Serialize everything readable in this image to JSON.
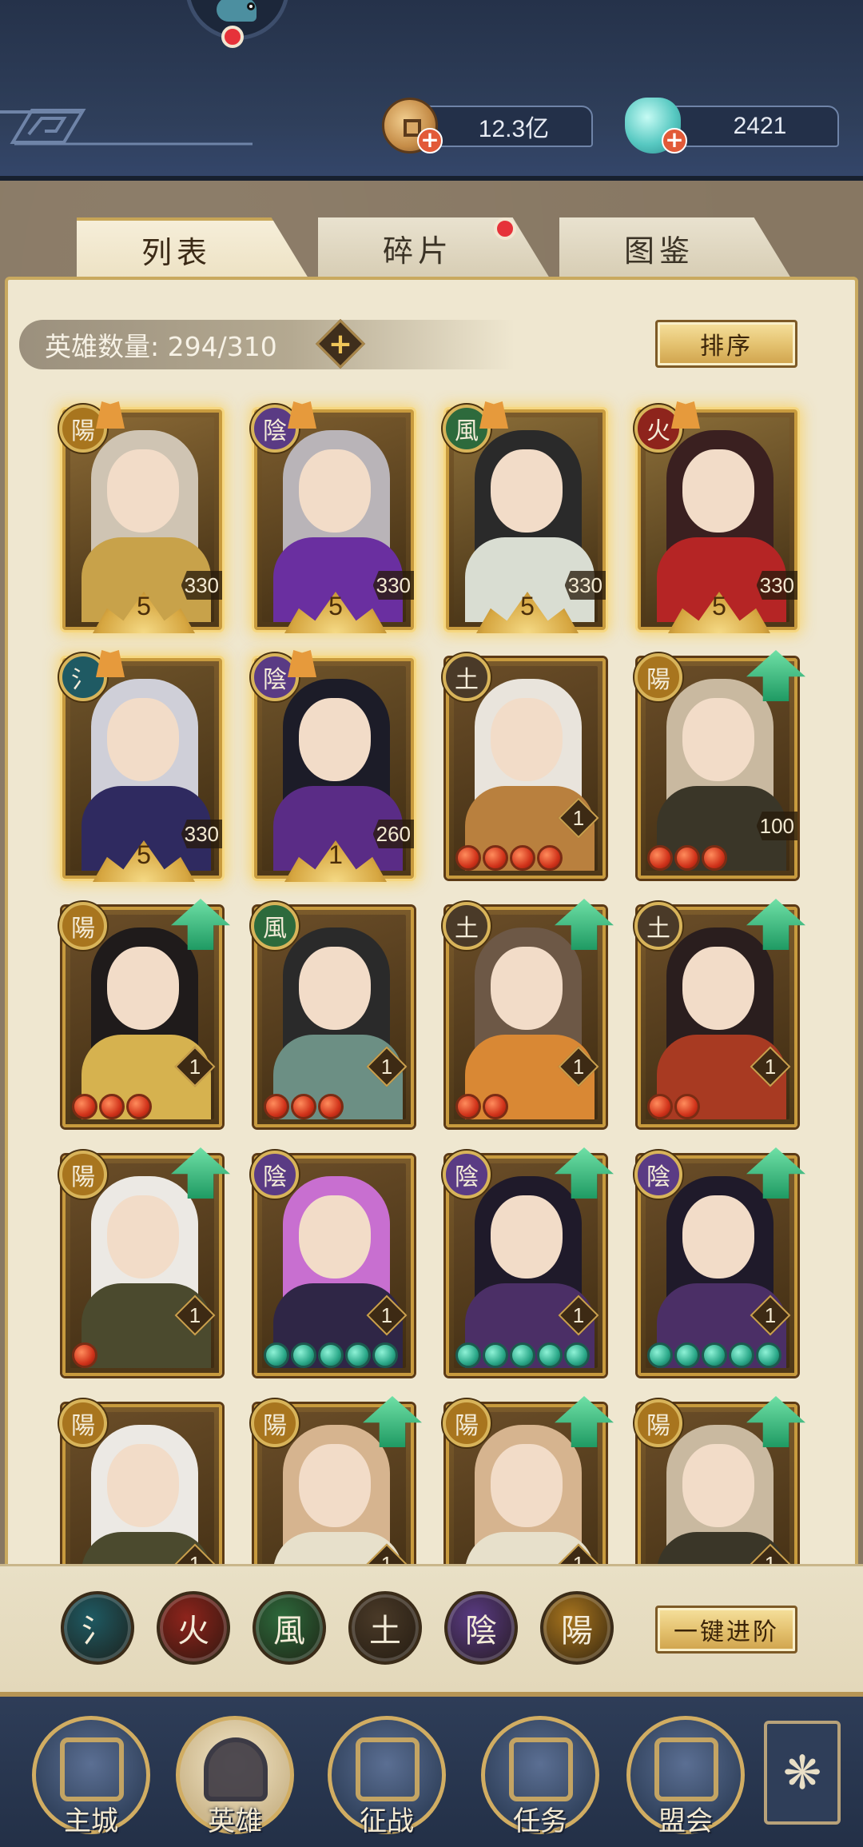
{
  "header": {
    "coins": "12.3亿",
    "gems": "2421"
  },
  "tabs": [
    {
      "label": "列表",
      "active": true
    },
    {
      "label": "碎片",
      "active": false,
      "has_dot": true
    },
    {
      "label": "图鉴",
      "active": false
    }
  ],
  "roster": {
    "count_label": "英雄数量: 294/310",
    "sort_label": "排序"
  },
  "elements": {
    "water": {
      "glyph": "氵",
      "color": "#1f5a63"
    },
    "fire": {
      "glyph": "火",
      "color": "#8e241c"
    },
    "wind": {
      "glyph": "風",
      "color": "#2d6a3c"
    },
    "earth": {
      "glyph": "土",
      "color": "#4a3a28"
    },
    "yin": {
      "glyph": "陰",
      "color": "#5a3b84"
    },
    "yang": {
      "glyph": "陽",
      "color": "#a8751e"
    }
  },
  "heroes": [
    {
      "element": "yang",
      "stars": "5",
      "level": "330",
      "hair": "#cfc4b3",
      "robe": "#c8a24a",
      "bg": "#8b6a36",
      "glow": true
    },
    {
      "element": "yin",
      "stars": "5",
      "level": "330",
      "hair": "#b9b4b8",
      "robe": "#6a2fa0",
      "bg": "#7b5c2e",
      "glow": true
    },
    {
      "element": "wind",
      "stars": "5",
      "level": "330",
      "hair": "#2a2a2a",
      "robe": "#d9ddd2",
      "bg": "#8a6d38",
      "glow": true
    },
    {
      "element": "fire",
      "stars": "5",
      "level": "330",
      "hair": "#3a2020",
      "robe": "#b52525",
      "bg": "#8a6d38",
      "glow": true
    },
    {
      "element": "water",
      "stars": "5",
      "level": "330",
      "hair": "#cfcfd8",
      "robe": "#2f2a60",
      "bg": "#6e532a",
      "glow": true
    },
    {
      "element": "yin",
      "stars": "1",
      "level": "260",
      "hair": "#1c1c28",
      "robe": "#5a2c86",
      "bg": "#6e532a",
      "glow": true
    },
    {
      "element": "earth",
      "level": "1",
      "hair": "#e9e4dc",
      "robe": "#b9803e",
      "bg": "#6a4d28",
      "beads": 4,
      "bead_type": "red"
    },
    {
      "element": "yang",
      "level": "100",
      "hair": "#c9b9a0",
      "robe": "#3a3628",
      "bg": "#6a4d28",
      "beads": 3,
      "bead_type": "red",
      "upgrade": true
    },
    {
      "element": "yang",
      "level": "1",
      "hair": "#1f1b1b",
      "robe": "#d6b24f",
      "bg": "#6a4d28",
      "beads": 3,
      "bead_type": "red",
      "upgrade": true
    },
    {
      "element": "wind",
      "level": "1",
      "hair": "#2a2a2a",
      "robe": "#6c8f84",
      "bg": "#6a4d28",
      "beads": 3,
      "bead_type": "red"
    },
    {
      "element": "earth",
      "level": "1",
      "hair": "#6d5846",
      "robe": "#d98834",
      "bg": "#6a4d28",
      "beads": 2,
      "bead_type": "red",
      "upgrade": true
    },
    {
      "element": "earth",
      "level": "1",
      "hair": "#2a1e1e",
      "robe": "#a83a22",
      "bg": "#6a4d28",
      "beads": 2,
      "bead_type": "red",
      "upgrade": true
    },
    {
      "element": "yang",
      "level": "1",
      "hair": "#ece9e4",
      "robe": "#4b4a2e",
      "bg": "#6a4d28",
      "beads": 1,
      "bead_type": "red",
      "upgrade": true
    },
    {
      "element": "yin",
      "level": "1",
      "hair": "#c86fd0",
      "robe": "#2f2646",
      "bg": "#6a4d28",
      "beads": 5,
      "bead_type": "jade"
    },
    {
      "element": "yin",
      "level": "1",
      "hair": "#1f1a2a",
      "robe": "#4b2f66",
      "bg": "#6a4d28",
      "beads": 5,
      "bead_type": "jade",
      "upgrade": true
    },
    {
      "element": "yin",
      "level": "1",
      "hair": "#1f1a2a",
      "robe": "#4b2f66",
      "bg": "#6a4d28",
      "beads": 5,
      "bead_type": "jade",
      "upgrade": true
    },
    {
      "element": "yang",
      "level": "1",
      "hair": "#ece9e4",
      "robe": "#4b4a2e",
      "bg": "#6a4d28"
    },
    {
      "element": "yang",
      "level": "1",
      "hair": "#d6b48f",
      "robe": "#e7e0cb",
      "bg": "#6a4d28",
      "upgrade": true
    },
    {
      "element": "yang",
      "level": "1",
      "hair": "#d6b48f",
      "robe": "#e7e0cb",
      "bg": "#6a4d28",
      "upgrade": true
    },
    {
      "element": "yang",
      "level": "1",
      "hair": "#c9b9a0",
      "robe": "#3a3628",
      "bg": "#6a4d28",
      "upgrade": true
    }
  ],
  "element_filter": [
    "water",
    "fire",
    "wind",
    "earth",
    "yin",
    "yang"
  ],
  "advance_all_label": "一键进阶",
  "nav": [
    {
      "label": "主城",
      "icon": "palace-icon"
    },
    {
      "label": "英雄",
      "icon": "hero-portrait-icon",
      "active": true
    },
    {
      "label": "征战",
      "icon": "battle-icon"
    },
    {
      "label": "任务",
      "icon": "scroll-icon"
    },
    {
      "label": "盟会",
      "icon": "pavilion-icon"
    }
  ]
}
